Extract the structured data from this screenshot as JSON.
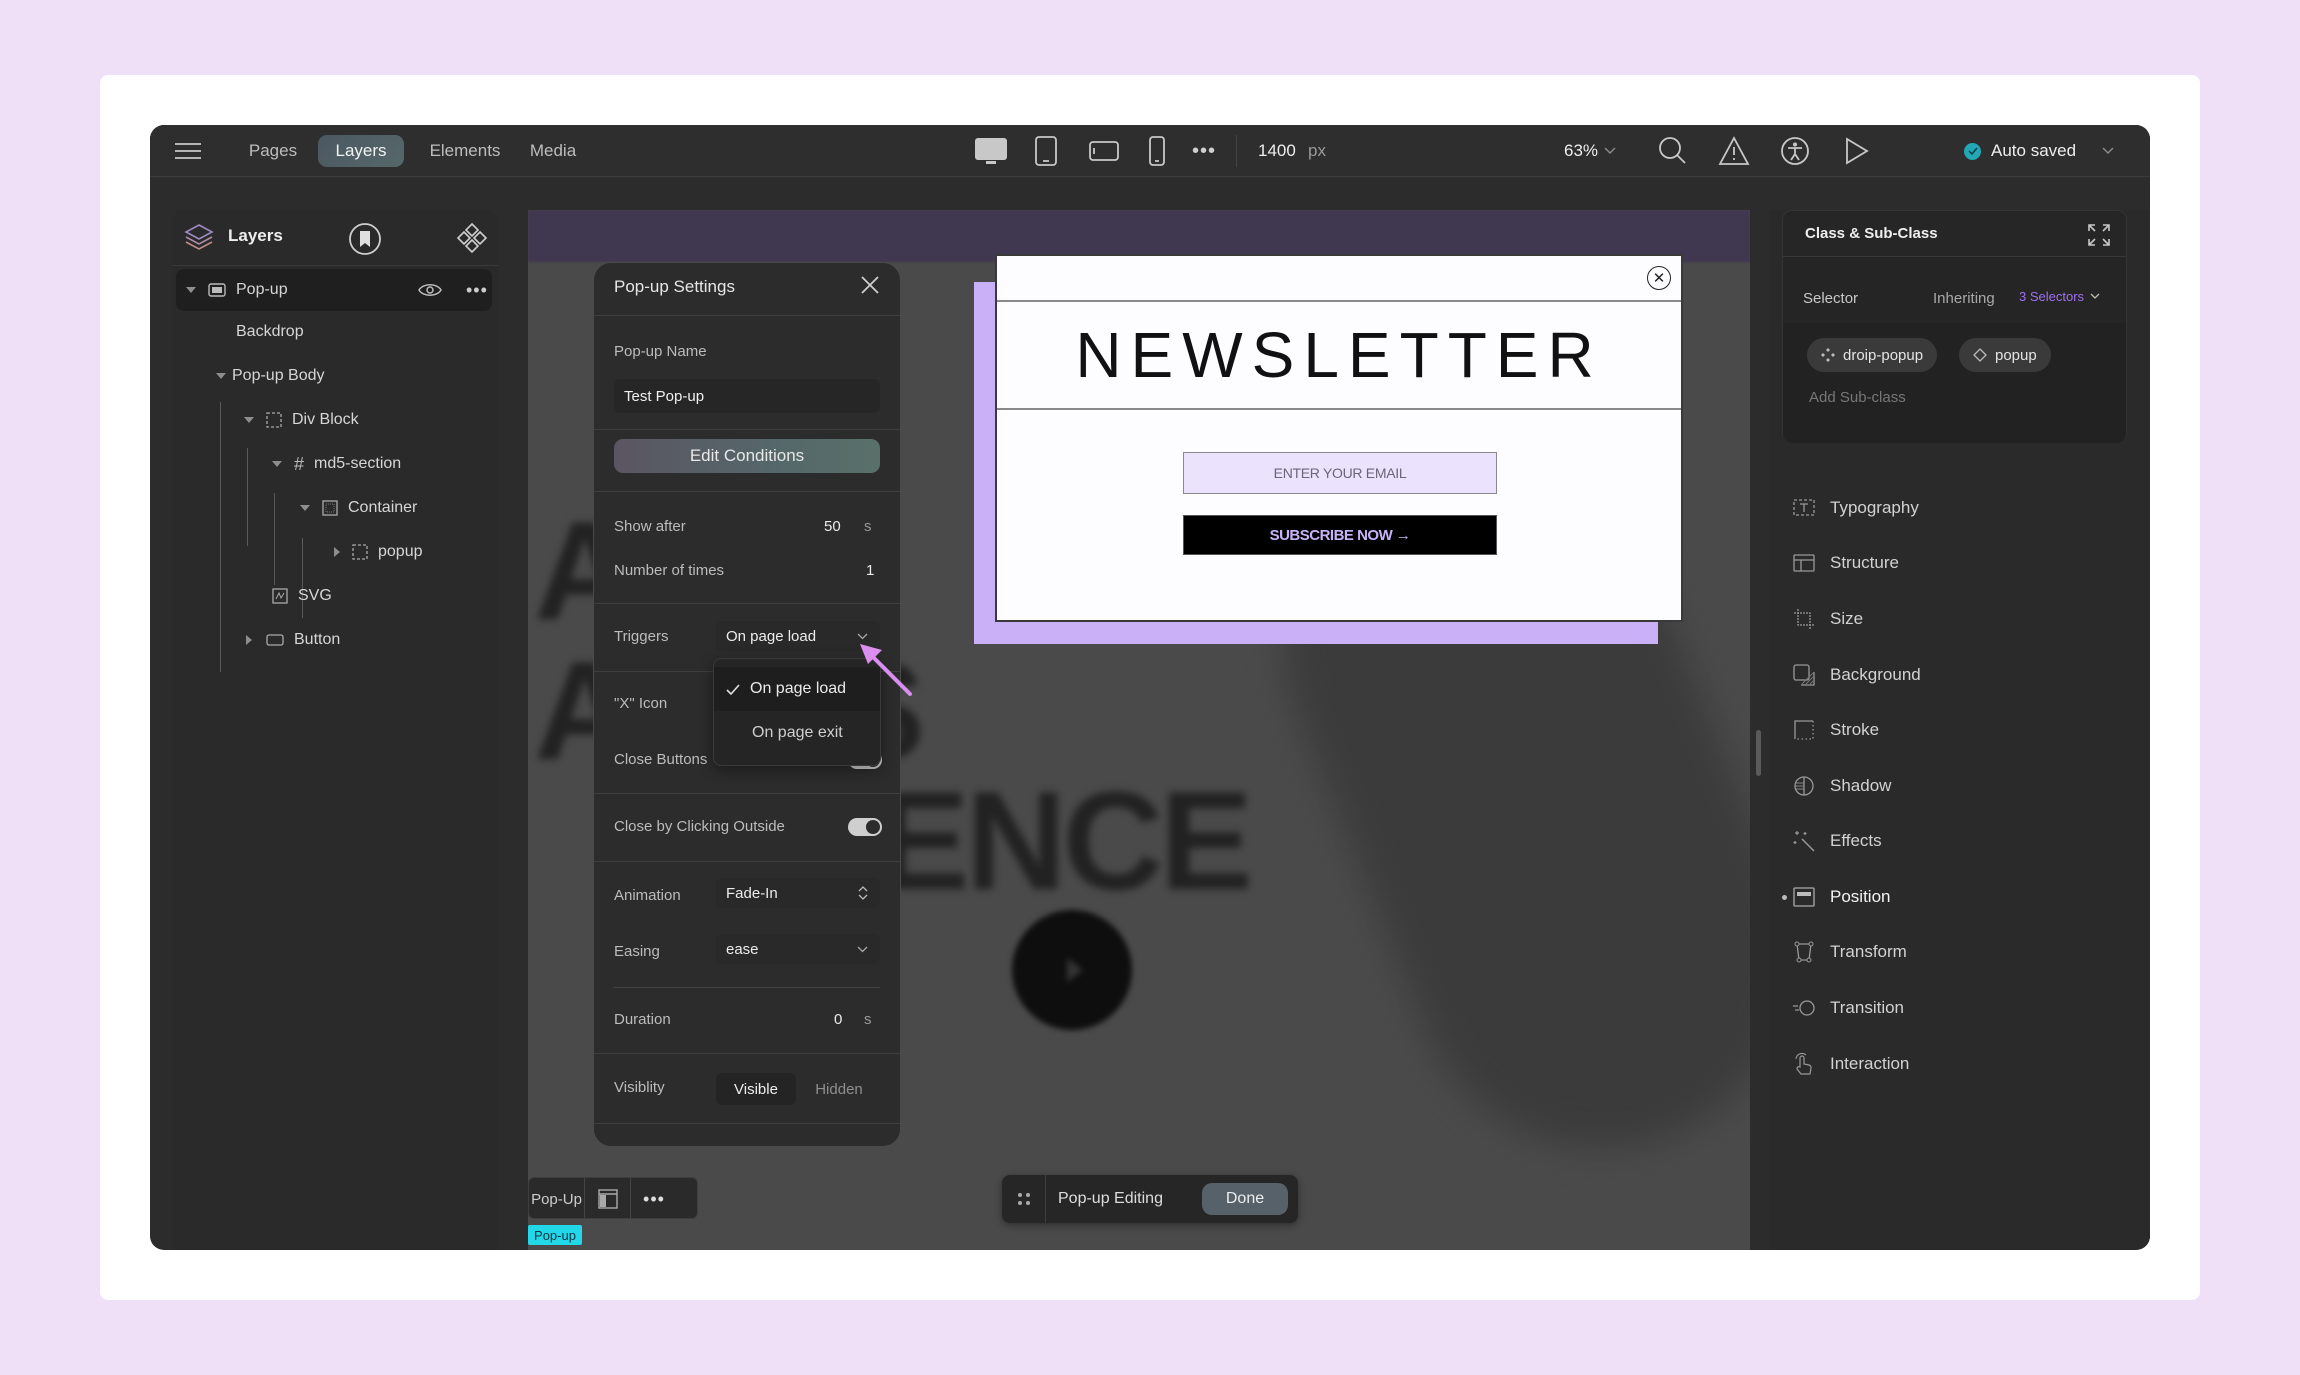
{
  "topbar": {
    "tabs": [
      {
        "label": "Pages",
        "active": false
      },
      {
        "label": "Layers",
        "active": true
      },
      {
        "label": "Elements",
        "active": false
      },
      {
        "label": "Media",
        "active": false
      }
    ],
    "devices": [
      "desktop",
      "tablet",
      "tablet-landscape",
      "mobile"
    ],
    "width_value": "1400",
    "width_unit": "px",
    "zoom": "63%",
    "save_status": "Auto saved",
    "status_color": "#23a6b5"
  },
  "layers_panel": {
    "title": "Layers",
    "items": [
      {
        "label": "Pop-up",
        "icon": "popup-icon",
        "selected": true
      },
      {
        "label": "Backdrop"
      },
      {
        "label": "Pop-up Body"
      },
      {
        "label": "Div Block",
        "icon": "div-block-icon"
      },
      {
        "label": "md5-section",
        "icon": "section-icon"
      },
      {
        "label": "Container",
        "icon": "container-icon"
      },
      {
        "label": "popup",
        "icon": "div-block-icon"
      },
      {
        "label": "SVG",
        "icon": "svg-icon"
      },
      {
        "label": "Button",
        "icon": "button-icon"
      }
    ]
  },
  "popup_settings": {
    "title": "Pop-up Settings",
    "name_label": "Pop-up Name",
    "name_value": "Test Pop-up",
    "edit_conditions": "Edit Conditions",
    "show_after_label": "Show after",
    "show_after_value": "50",
    "show_after_unit": "s",
    "times_label": "Number of times",
    "times_value": "1",
    "triggers_label": "Triggers",
    "triggers_value": "On page load",
    "trigger_options": [
      {
        "label": "On page load",
        "selected": true
      },
      {
        "label": "On page exit",
        "selected": false
      }
    ],
    "x_icon_label": "\"X\" Icon",
    "close_buttons_label": "Close Buttons",
    "close_outside_label": "Close by Clicking Outside",
    "close_outside_on": true,
    "animation_label": "Animation",
    "animation_value": "Fade-In",
    "easing_label": "Easing",
    "easing_value": "ease",
    "duration_label": "Duration",
    "duration_value": "0",
    "duration_unit": "s",
    "visibility_label": "Visiblity",
    "visibility_options": [
      "Visible",
      "Hidden"
    ],
    "visibility_selected": "Visible"
  },
  "newsletter": {
    "title": "NEWSLETTER",
    "email_placeholder": "ENTER YOUR EMAIL",
    "subscribe_label": "SUBSCRIBE NOW →",
    "accent_color": "#c9b0f7"
  },
  "canvas_bg": {
    "line1": "A",
    "line1b": "a",
    "line2": "A   STS",
    "line3": "FLUENCE"
  },
  "class_panel": {
    "title": "Class & Sub-Class",
    "selector_label": "Selector",
    "inheriting_label": "Inheriting",
    "selectors_count": "3 Selectors",
    "chips": [
      "droip-popup",
      "popup"
    ],
    "add_subclass": "Add Sub-class"
  },
  "properties": [
    {
      "label": "Typography",
      "active": false
    },
    {
      "label": "Structure",
      "active": false
    },
    {
      "label": "Size",
      "active": false
    },
    {
      "label": "Background",
      "active": false
    },
    {
      "label": "Stroke",
      "active": false
    },
    {
      "label": "Shadow",
      "active": false
    },
    {
      "label": "Effects",
      "active": false
    },
    {
      "label": "Position",
      "active": true
    },
    {
      "label": "Transform",
      "active": false
    },
    {
      "label": "Transition",
      "active": false
    },
    {
      "label": "Interaction",
      "active": false
    }
  ],
  "bottom_bar": {
    "popup_label": "Pop-Up",
    "editing_label": "Pop-up Editing",
    "done_label": "Done",
    "element_tag": "Pop-up"
  }
}
